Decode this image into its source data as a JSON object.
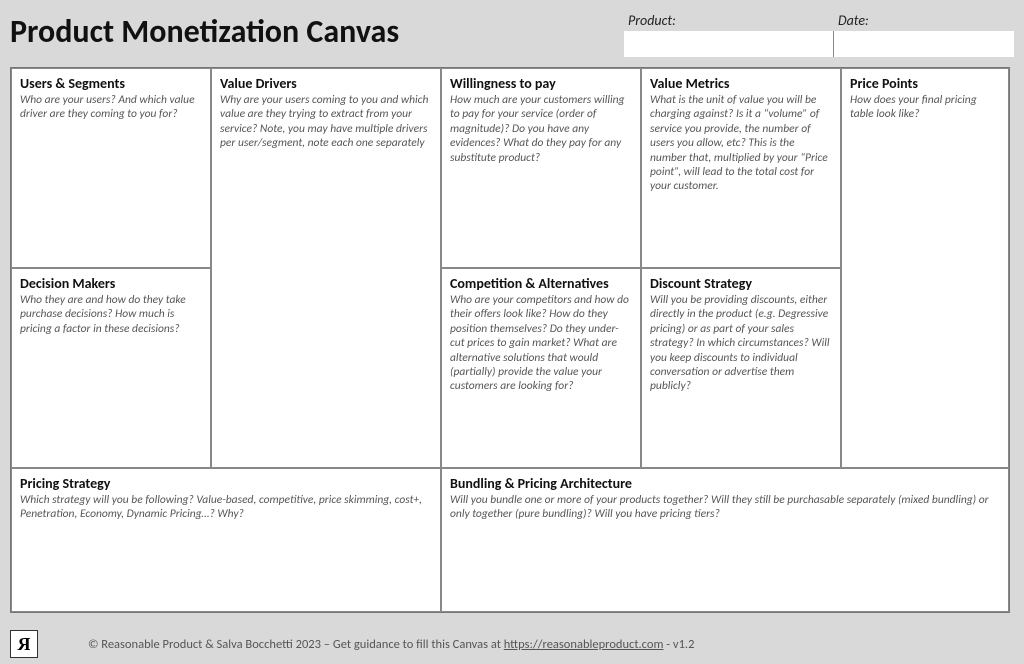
{
  "title": "Product Monetization Canvas",
  "meta": {
    "product_label": "Product:",
    "date_label": "Date:"
  },
  "cells": {
    "users": {
      "title": "Users & Segments",
      "desc": "Who are your users? And which value driver are they coming to you for?"
    },
    "value": {
      "title": "Value Drivers",
      "desc": "Why are your users coming to you and which value are they trying to extract from your service? Note, you may have multiple drivers per user/segment, note each one separately"
    },
    "wtp": {
      "title": "Willingness to pay",
      "desc": "How much are your customers willing to pay for your service (order of magnitude)? Do you have any evidences? What do they pay for any substitute product?"
    },
    "metrics": {
      "title": "Value Metrics",
      "desc": "What is the unit of value you will be charging against? Is it a “volume” of service you provide, the number of users you allow, etc? This is the number that, multiplied by your “Price point”, will lead to the total cost for your customer."
    },
    "price": {
      "title": "Price Points",
      "desc": "How does your final pricing table look like?"
    },
    "decision": {
      "title": "Decision Makers",
      "desc": "Who they are and how do they take purchase decisions? How much is pricing a factor in these decisions?"
    },
    "comp": {
      "title": "Competition & Alternatives",
      "desc": "Who are your competitors and how do their offers look like? How do they position themselves?  Do they under-cut prices to gain market? What are alternative solutions that would (partially) provide the value your customers are looking for?"
    },
    "discount": {
      "title": "Discount Strategy",
      "desc": "Will you be providing discounts, either directly in the product (e.g. Degressive pricing) or as part of your sales strategy? In which circumstances? Will you keep discounts to individual conversation or advertise them publicly?"
    },
    "strategy": {
      "title": "Pricing Strategy",
      "desc": "Which strategy will you be following? Value-based, competitive, price skimming, cost+, Penetration, Economy, Dynamic Pricing…?  Why?"
    },
    "bundle": {
      "title": "Bundling & Pricing Architecture",
      "desc": "Will you bundle one or more of your products together? Will they still be purchasable separately (mixed bundling) or only together (pure bundling)? Will you have pricing tiers?"
    }
  },
  "footer": {
    "logo_letter": "R",
    "prefix": "© Reasonable Product & Salva Bocchetti 2023 –  Get guidance to fill this Canvas at ",
    "link_text": "https://reasonableproduct.com",
    "suffix": "  - v1.2"
  }
}
